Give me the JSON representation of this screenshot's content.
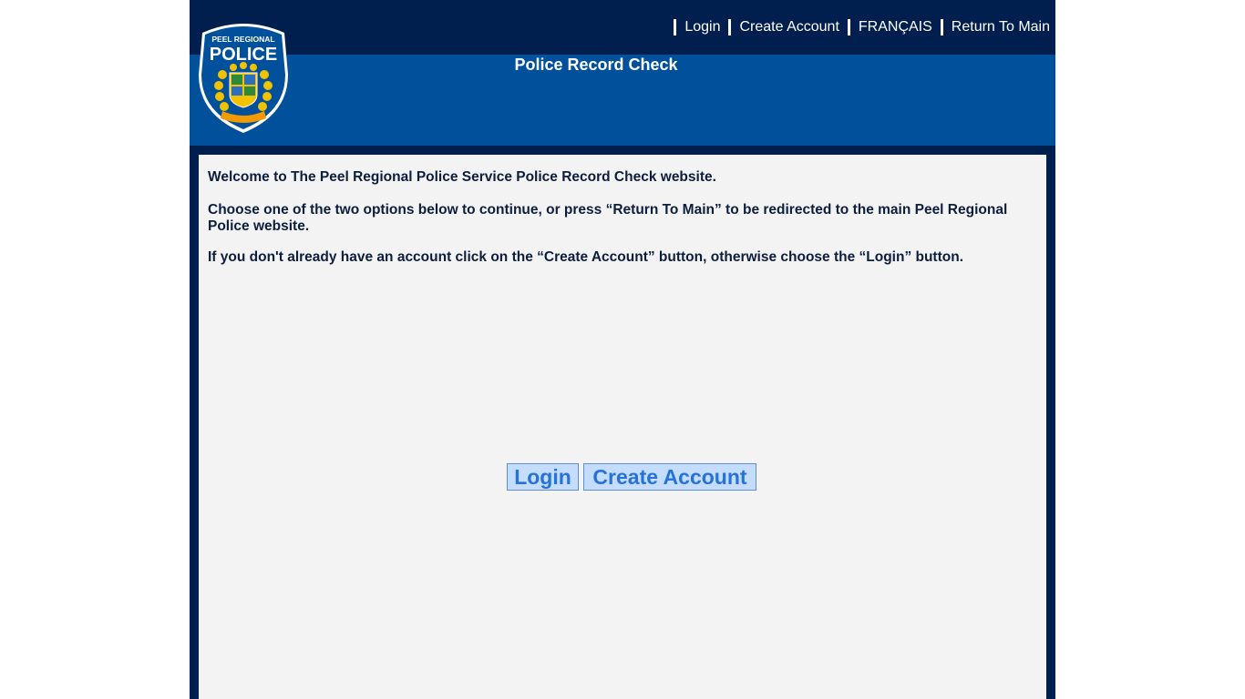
{
  "nav": {
    "items": [
      "Login",
      "Create Account",
      "FRANÇAIS",
      "Return To Main"
    ]
  },
  "logo": {
    "line1": "PEEL REGIONAL",
    "line2": "POLICE"
  },
  "header": {
    "title": "Police Record Check"
  },
  "main": {
    "paragraphs": [
      "Welcome to The Peel Regional Police Service Police Record Check website.",
      "Choose one of the two options below to continue, or press “Return To Main” to be redirected to the main Peel Regional Police website.",
      "If you don't already have an account click on the “Create Account” button, otherwise choose the “Login” button."
    ],
    "login_label": "Login",
    "create_label": "Create Account"
  },
  "colors": {
    "navy": "#001e4e",
    "banner_blue": "#00509c",
    "content_bg": "#f3f3f3",
    "button_bg": "#c4ddff",
    "button_text": "#2672d8"
  }
}
